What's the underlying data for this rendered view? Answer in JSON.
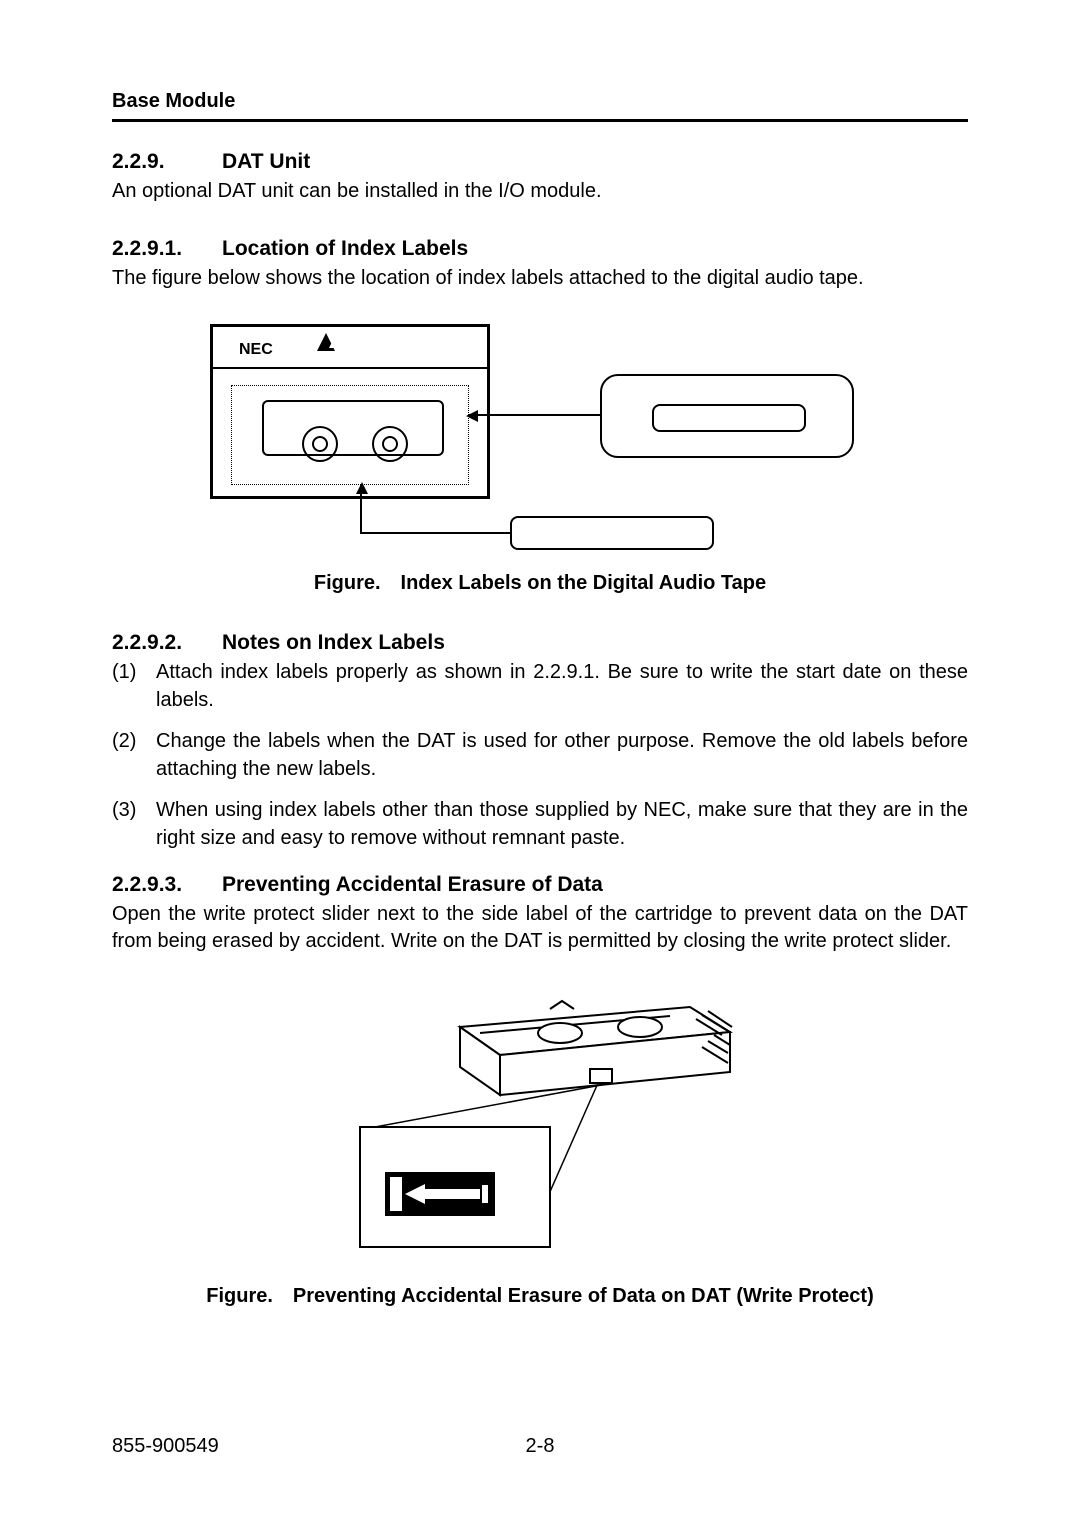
{
  "header": {
    "running": "Base Module"
  },
  "sections": {
    "s229": {
      "num": "2.2.9.",
      "title": "DAT Unit",
      "body": "An optional DAT unit can be installed in the I/O module."
    },
    "s2291": {
      "num": "2.2.9.1.",
      "title": "Location of Index Labels",
      "body": "The figure below shows the location of index labels attached to the digital audio tape."
    },
    "s2292": {
      "num": "2.2.9.2.",
      "title": "Notes on Index Labels"
    },
    "s2293": {
      "num": "2.2.9.3.",
      "title": "Preventing Accidental Erasure of Data",
      "body": "Open the write protect slider next to the side label of the cartridge to prevent data on the DAT from being erased by accident. Write on the DAT is permitted by closing the write protect slider."
    }
  },
  "figure1": {
    "nec": "NEC",
    "caption": "Figure. Index Labels on the Digital Audio Tape"
  },
  "notes": {
    "items": [
      {
        "n": "(1)",
        "t": "Attach index labels properly as shown in 2.2.9.1. Be sure to write the start date on these labels."
      },
      {
        "n": "(2)",
        "t": "Change the labels when the DAT is used for other purpose. Remove the old labels before attaching the new labels."
      },
      {
        "n": "(3)",
        "t": "When using index labels other than those supplied by NEC, make sure that they are in the right size and easy to remove without remnant paste."
      }
    ]
  },
  "figure2": {
    "caption": "Figure. Preventing Accidental Erasure of Data on DAT (Write Protect)"
  },
  "footer": {
    "docnum": "855-900549",
    "pagenum": "2-8"
  }
}
